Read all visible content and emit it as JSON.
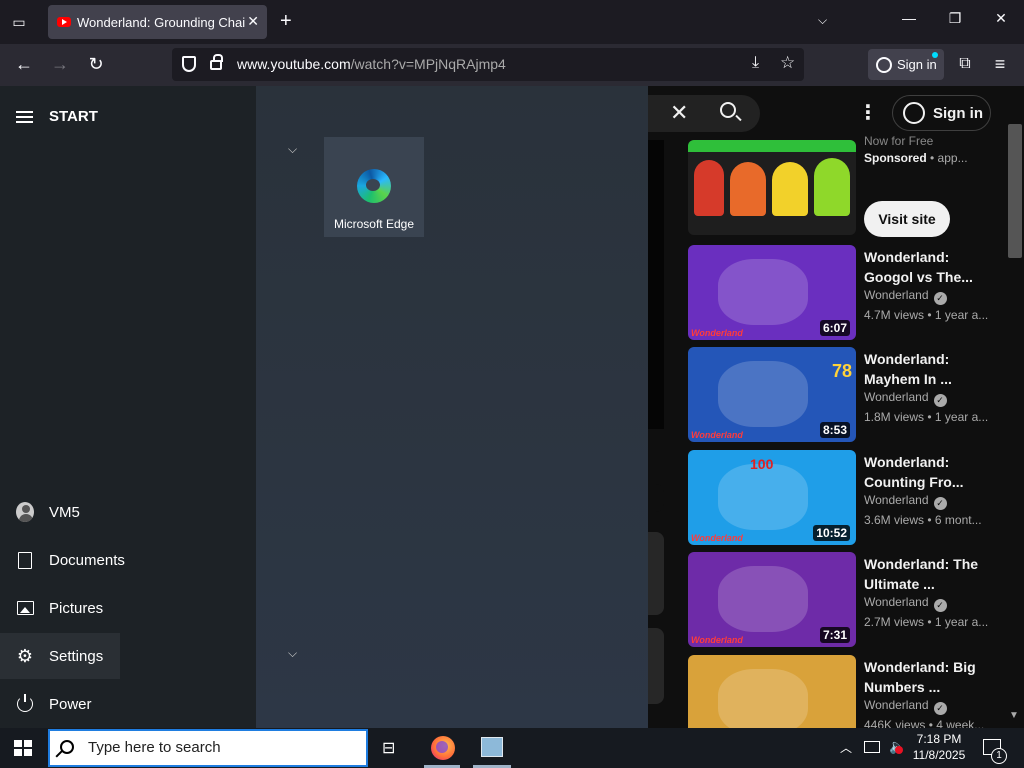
{
  "browser": {
    "tab_title": "Wonderland: Grounding Chain",
    "url_host": "www.youtube.com",
    "url_path": "/watch?v=MPjNqRAjmp4",
    "signin_label": "Sign in"
  },
  "youtube": {
    "signin_label": "Sign in",
    "ad": {
      "top_text": "Now for Free",
      "sponsored": "Sponsored",
      "advertiser": " • app...",
      "visit_label": "Visit site"
    },
    "recommendations": [
      {
        "title": "Wonderland: Googol vs The...",
        "channel": "Wonderland",
        "meta": "4.7M views • 1 year a...",
        "duration": "6:07",
        "thumb_color": "#6a2fbf"
      },
      {
        "title": "Wonderland: Mayhem In ...",
        "channel": "Wonderland",
        "meta": "1.8M views • 1 year a...",
        "duration": "8:53",
        "thumb_color": "#2456b8"
      },
      {
        "title": "Wonderland: Counting Fro...",
        "channel": "Wonderland",
        "meta": "3.6M views • 6 mont...",
        "duration": "10:52",
        "thumb_color": "#1f9ee8"
      },
      {
        "title": "Wonderland: The Ultimate ...",
        "channel": "Wonderland",
        "meta": "2.7M views • 1 year a...",
        "duration": "7:31",
        "thumb_color": "#6e2ba8"
      },
      {
        "title": "Wonderland: Big Numbers ...",
        "channel": "Wonderland",
        "meta": "446K views • 4 week...",
        "duration": "",
        "thumb_color": "#d9a23a"
      }
    ],
    "thumb_brand": "Wonderland",
    "thumb_counter_1": "100",
    "thumb_counter_2": "78"
  },
  "start_menu": {
    "title": "START",
    "user": "VM5",
    "documents": "Documents",
    "pictures": "Pictures",
    "settings": "Settings",
    "power": "Power",
    "tile_label": "Microsoft Edge"
  },
  "taskbar": {
    "search_placeholder": "Type here to search",
    "time": "7:18 PM",
    "date": "11/8/2025",
    "notification_count": "1"
  }
}
